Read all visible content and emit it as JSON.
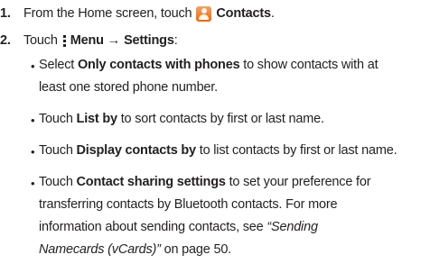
{
  "steps": [
    {
      "number": "1.",
      "prefix": "From the Home screen, touch",
      "icon": "contacts-app-icon",
      "target": "Contacts",
      "suffix": "."
    },
    {
      "number": "2.",
      "prefix": "Touch",
      "icon": "menu-icon",
      "target": "Menu",
      "arrow": "→",
      "target2": "Settings",
      "suffix": ":"
    }
  ],
  "bullets": [
    {
      "lead": "Select ",
      "bold": "Only contacts with phones",
      "line1_rest": " to show contacts with at",
      "line2": "least one stored phone number."
    },
    {
      "lead": "Touch ",
      "bold": "List by",
      "line1_rest": " to sort contacts by first or last name."
    },
    {
      "lead": "Touch ",
      "bold": "Display contacts by",
      "line1_rest": " to list contacts by first or last name."
    },
    {
      "lead": "Touch ",
      "bold": "Contact sharing settings",
      "line1_rest": " to set your preference for",
      "line2": "transferring contacts by Bluetooth contacts. For more",
      "line3_lead": "information about sending contacts, see ",
      "line3_italic": "“Sending",
      "line4_italic": "Namecards (vCards)”",
      "line4_rest": " on page 50."
    }
  ],
  "bullet_char": "•"
}
